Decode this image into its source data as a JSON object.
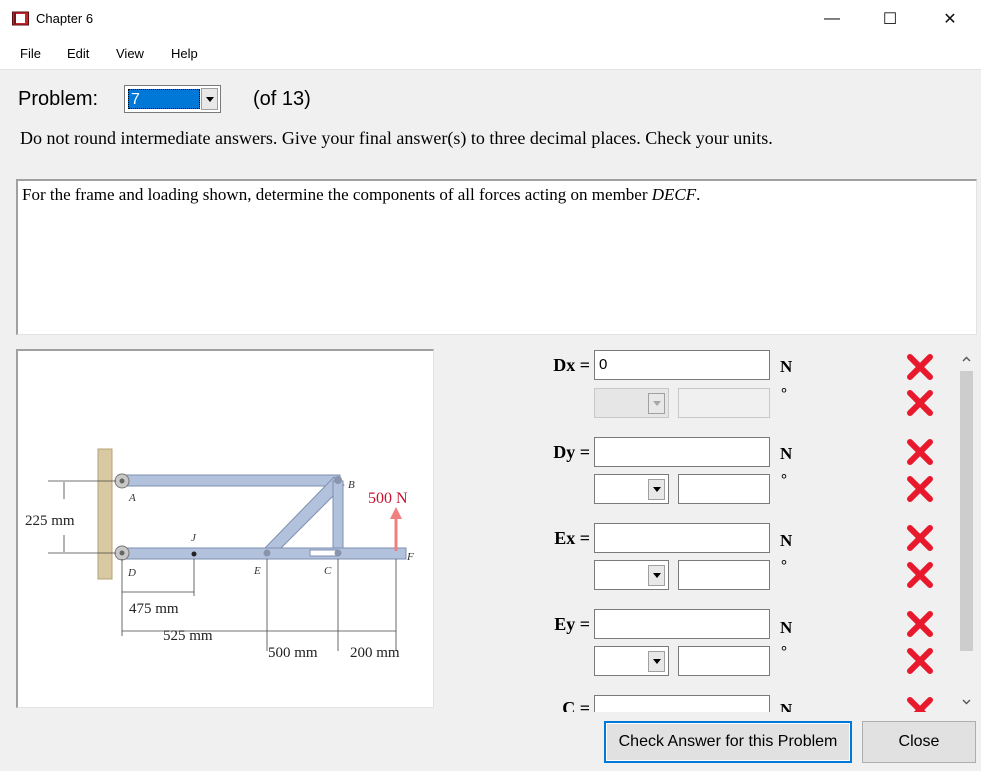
{
  "window": {
    "title": "Chapter 6",
    "minimize": "—",
    "maximize": "☐",
    "close": "✕"
  },
  "menu": {
    "file": "File",
    "edit": "Edit",
    "view": "View",
    "help": "Help"
  },
  "problem": {
    "label": "Problem:",
    "selected": "7",
    "of": "(of 13)"
  },
  "instructions": "Do not round intermediate answers.  Give your final answer(s) to three decimal places.  Check your units.",
  "statement": {
    "prefix": "For the frame and loading shown, determine the components of all forces acting on member ",
    "member": "DECF",
    "suffix": "."
  },
  "figure": {
    "load": "500 N",
    "height": "225 mm",
    "dims": [
      "475 mm",
      "525 mm",
      "500 mm",
      "200 mm"
    ],
    "points": [
      "A",
      "B",
      "C",
      "D",
      "E",
      "F",
      "J"
    ]
  },
  "fields": [
    {
      "label": "Dx =",
      "value": "0",
      "unit": "N",
      "deg": "°"
    },
    {
      "label": "Dy =",
      "value": "",
      "unit": "N",
      "deg": "°"
    },
    {
      "label": "Ex =",
      "value": "",
      "unit": "N",
      "deg": "°"
    },
    {
      "label": "Ey =",
      "value": "",
      "unit": "N",
      "deg": "°"
    },
    {
      "label": "C =",
      "value": "",
      "unit": "N"
    }
  ],
  "status_icons": [
    "x-mark",
    "x-mark",
    "x-mark",
    "x-mark",
    "x-mark",
    "x-mark",
    "x-mark",
    "x-mark",
    "x-mark"
  ],
  "colors": {
    "wrong": "#e8192c",
    "selection": "#0078d7",
    "load_arrow": "#f08080"
  },
  "buttons": {
    "check": "Check Answer for this Problem",
    "close": "Close"
  }
}
